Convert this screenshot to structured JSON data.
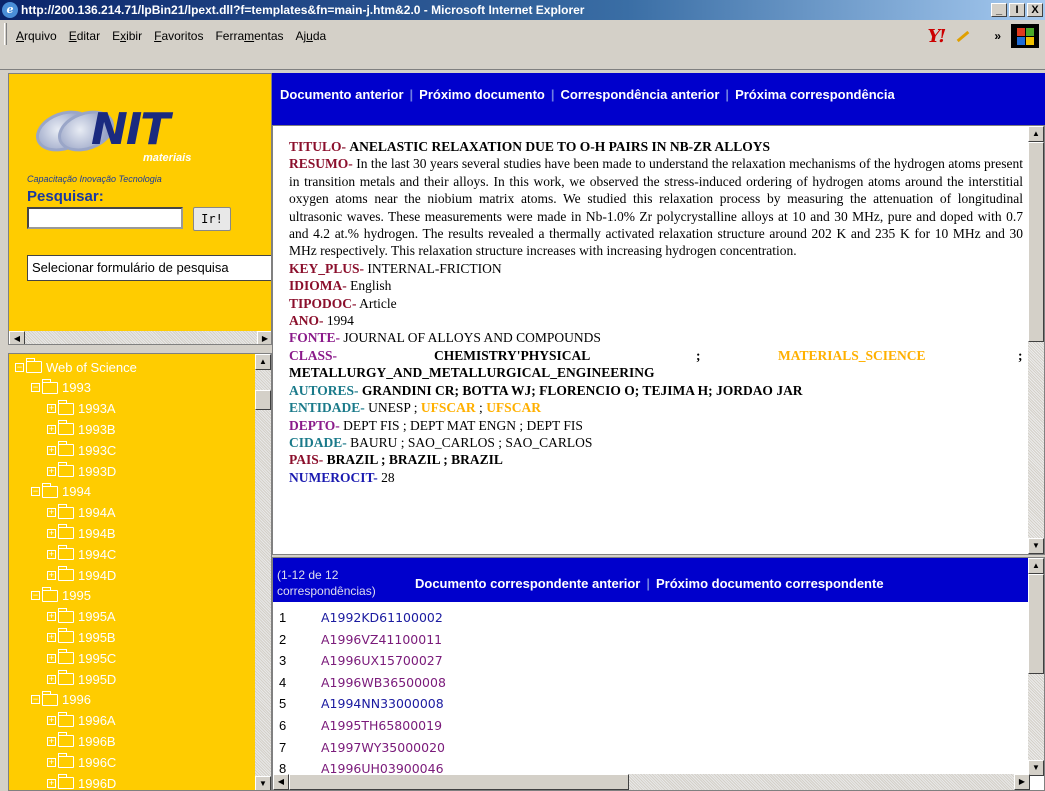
{
  "window": {
    "title": "http://200.136.214.71/lpBin21/lpext.dll?f=templates&fn=main-j.htm&2.0 - Microsoft Internet Explorer",
    "minimize": "_",
    "maximize": "І",
    "close": "X"
  },
  "menu": {
    "items": [
      {
        "pre": "",
        "u": "A",
        "post": "rquivo"
      },
      {
        "pre": "",
        "u": "E",
        "post": "ditar"
      },
      {
        "pre": "E",
        "u": "x",
        "post": "ibir"
      },
      {
        "pre": "",
        "u": "F",
        "post": "avoritos"
      },
      {
        "pre": "Ferra",
        "u": "m",
        "post": "entas"
      },
      {
        "pre": "Aj",
        "u": "u",
        "post": "da"
      }
    ],
    "yahoo": "Y!",
    "more": "»"
  },
  "sidebar": {
    "logo_text": "NIT",
    "logo_sub": "materiais",
    "tagline": "Capacitação Inovação Tecnologia",
    "search_label": "Pesquisar:",
    "search_value": "",
    "go_button": "Ir!",
    "form_select": "Selecionar formulário de pesquisa"
  },
  "tree": [
    {
      "label": "Web of Science",
      "level": 0,
      "expanded": true
    },
    {
      "label": "1993",
      "level": 1,
      "expanded": true
    },
    {
      "label": "1993A",
      "level": 2,
      "expanded": false
    },
    {
      "label": "1993B",
      "level": 2,
      "expanded": false
    },
    {
      "label": "1993C",
      "level": 2,
      "expanded": false
    },
    {
      "label": "1993D",
      "level": 2,
      "expanded": false
    },
    {
      "label": "1994",
      "level": 1,
      "expanded": true
    },
    {
      "label": "1994A",
      "level": 2,
      "expanded": false
    },
    {
      "label": "1994B",
      "level": 2,
      "expanded": false
    },
    {
      "label": "1994C",
      "level": 2,
      "expanded": false
    },
    {
      "label": "1994D",
      "level": 2,
      "expanded": false
    },
    {
      "label": "1995",
      "level": 1,
      "expanded": true
    },
    {
      "label": "1995A",
      "level": 2,
      "expanded": false
    },
    {
      "label": "1995B",
      "level": 2,
      "expanded": false
    },
    {
      "label": "1995C",
      "level": 2,
      "expanded": false
    },
    {
      "label": "1995D",
      "level": 2,
      "expanded": false
    },
    {
      "label": "1996",
      "level": 1,
      "expanded": true
    },
    {
      "label": "1996A",
      "level": 2,
      "expanded": false
    },
    {
      "label": "1996B",
      "level": 2,
      "expanded": false
    },
    {
      "label": "1996C",
      "level": 2,
      "expanded": false
    },
    {
      "label": "1996D",
      "level": 2,
      "expanded": false
    }
  ],
  "nav": {
    "prev_doc": "Documento anterior",
    "next_doc": "Próximo documento",
    "prev_hit": "Correspondência anterior",
    "next_hit": "Próxima correspondência"
  },
  "document": {
    "titulo_label": "TITULO-",
    "titulo": "ANELASTIC RELAXATION DUE TO O-H PAIRS IN NB-ZR ALLOYS",
    "resumo_label": "RESUMO-",
    "resumo": "In the last 30 years several studies have been made to understand the relaxation mechanisms of the hydrogen atoms present in transition metals and their alloys. In this work, we observed the stress-induced ordering of hydrogen atoms around the interstitial oxygen atoms near the niobium matrix atoms. We studied this relaxation process by measuring the attenuation of longitudinal ultrasonic waves. These measurements were made in Nb-1.0% Zr polycrystalline alloys at 10 and 30 MHz, pure and doped with 0.7 and 4.2 at.% hydrogen. The results revealed a thermally activated relaxation structure around 202 K and 235 K for 10 MHz and 30 MHz respectively. This relaxation structure increases with increasing hydrogen concentration.",
    "keyplus_label": "KEY_PLUS-",
    "keyplus": "INTERNAL-FRICTION",
    "idioma_label": "IDIOMA-",
    "idioma": "English",
    "tipodoc_label": "TIPODOC-",
    "tipodoc": "Article",
    "ano_label": "ANO-",
    "ano": "1994",
    "fonte_label": "FONTE-",
    "fonte": "JOURNAL OF ALLOYS AND COMPOUNDS",
    "class_label": "CLASS-",
    "class1": "CHEMISTRY'PHYSICAL",
    "class_sep": ";",
    "class2": "MATERIALS_SCIENCE",
    "class3": "METALLURGY_AND_METALLURGICAL_ENGINEERING",
    "autores_label": "AUTORES-",
    "autores": "GRANDINI CR; BOTTA WJ; FLORENCIO O; TEJIMA H; JORDAO JAR",
    "entidade_label": "ENTIDADE-",
    "entidade1": "UNESP ;",
    "entidade2": "UFSCAR",
    "entidade_sep": ";",
    "entidade3": "UFSCAR",
    "depto_label": "DEPTO-",
    "depto": "DEPT FIS ; DEPT MAT ENGN ; DEPT FIS",
    "cidade_label": "CIDADE-",
    "cidade": "BAURU ; SAO_CARLOS ; SAO_CARLOS",
    "pais_label": "PAIS-",
    "pais": "BRAZIL ; BRAZIL ; BRAZIL",
    "numerocit_label": "NUMEROCIT-",
    "numerocit": "28"
  },
  "hits": {
    "count_line1": "(1-12 de 12",
    "count_line2": "correspondências)",
    "prev_hit_doc": "Documento correspondente anterior",
    "next_hit_doc": "Próximo documento correspondente",
    "rows": [
      {
        "n": "1",
        "id": "A1992KD61100002",
        "visited": false
      },
      {
        "n": "2",
        "id": "A1996VZ41100011",
        "visited": true
      },
      {
        "n": "3",
        "id": "A1996UX15700027",
        "visited": true
      },
      {
        "n": "4",
        "id": "A1996WB36500008",
        "visited": true
      },
      {
        "n": "5",
        "id": "A1994NN33000008",
        "visited": false
      },
      {
        "n": "6",
        "id": "A1995TH65800019",
        "visited": true
      },
      {
        "n": "7",
        "id": "A1997WY35000020",
        "visited": true
      },
      {
        "n": "8",
        "id": "A1996UH03900046",
        "visited": true
      }
    ]
  }
}
